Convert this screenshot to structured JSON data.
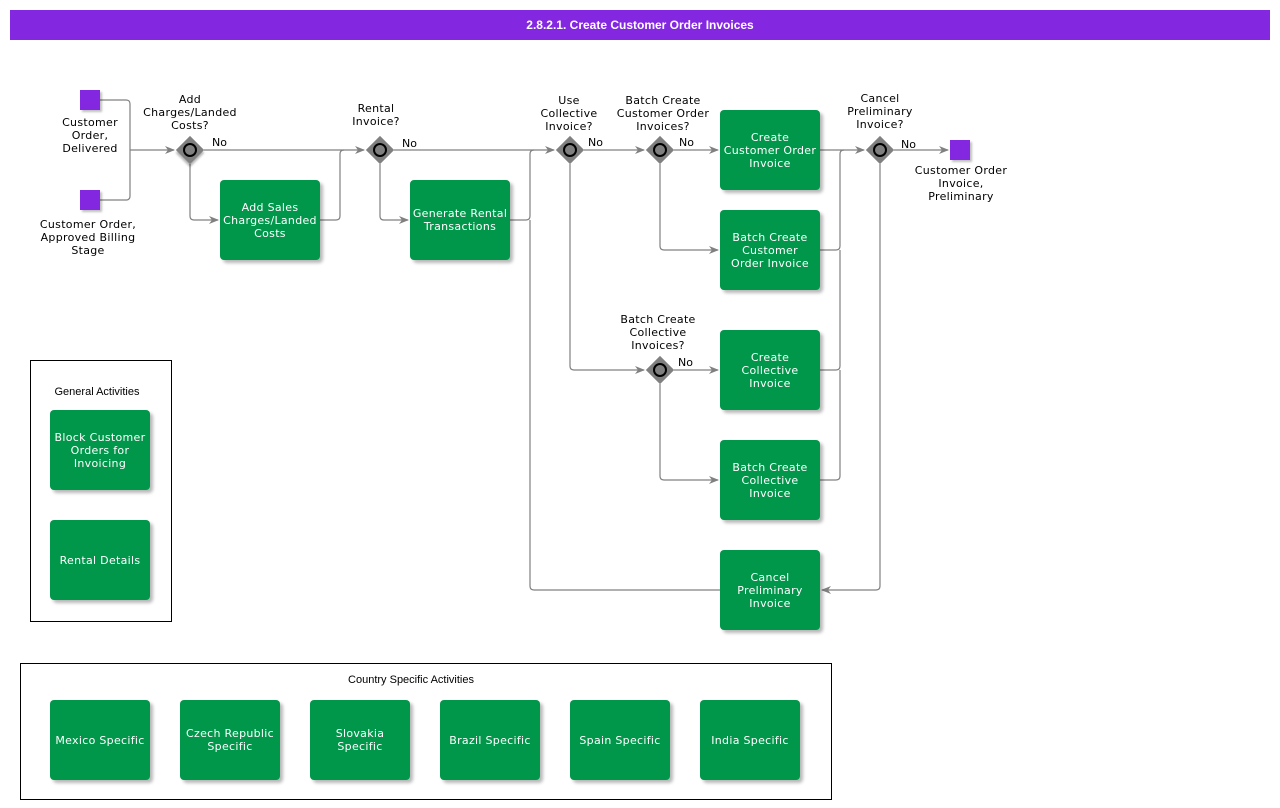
{
  "title": "2.8.2.1. Create Customer Order Invoices",
  "colors": {
    "accent": "#8427E0",
    "task": "#00974A",
    "gateway": "#808080",
    "connector": "#808080"
  },
  "events": {
    "start_delivered": "Customer\nOrder,\nDelivered",
    "start_approved": "Customer Order,\nApproved Billing\nStage",
    "end_preliminary": "Customer Order\nInvoice,\nPreliminary"
  },
  "gateways": {
    "add_charges": "Add\nCharges/Landed\nCosts?",
    "rental_invoice": "Rental\nInvoice?",
    "use_collective": "Use\nCollective\nInvoice?",
    "batch_co": "Batch Create\nCustomer Order\nInvoices?",
    "batch_collective": "Batch Create\nCollective\nInvoices?",
    "cancel_preliminary": "Cancel\nPreliminary\nInvoice?"
  },
  "no_label": "No",
  "tasks": {
    "add_sales_charges": "Add Sales\nCharges/Landed\nCosts",
    "generate_rental": "Generate Rental\nTransactions",
    "create_co_invoice": "Create\nCustomer Order\nInvoice",
    "batch_co_invoice": "Batch Create\nCustomer\nOrder Invoice",
    "create_collective": "Create\nCollective\nInvoice",
    "batch_collective": "Batch Create\nCollective\nInvoice",
    "cancel_preliminary": "Cancel\nPreliminary\nInvoice"
  },
  "general_activities": {
    "title": "General Activities",
    "items": [
      "Block Customer\nOrders for\nInvoicing",
      "Rental Details"
    ]
  },
  "country_activities": {
    "title": "Country Specific Activities",
    "items": [
      "Mexico Specific",
      "Czech Republic\nSpecific",
      "Slovakia\nSpecific",
      "Brazil Specific",
      "Spain Specific",
      "India Specific"
    ]
  }
}
